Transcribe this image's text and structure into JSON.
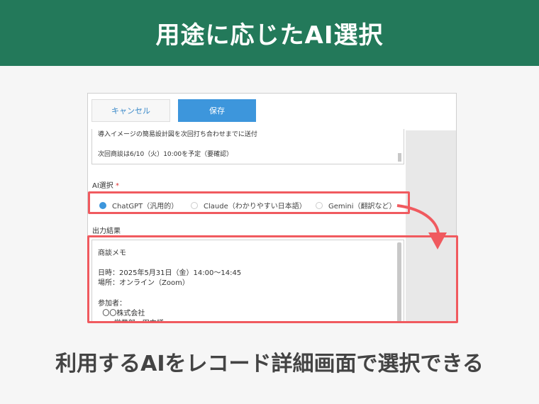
{
  "banner": {
    "title": "用途に応じたAI選択"
  },
  "toolbar": {
    "cancel_label": "キャンセル",
    "save_label": "保存"
  },
  "notes": {
    "line1": "導入イメージの簡易設計図を次回打ち合わせまでに送付",
    "line2": "次回商談は6/10（火）10:00を予定（要確認）"
  },
  "ai_select": {
    "label": "AI選択",
    "required_mark": "*",
    "options": [
      {
        "label": "ChatGPT（汎用的）",
        "selected": true
      },
      {
        "label": "Claude（わかりやすい日本語）",
        "selected": false
      },
      {
        "label": "Gemini（翻訳など）",
        "selected": false
      }
    ]
  },
  "output": {
    "label": "出力結果",
    "lines": [
      "商談メモ",
      "",
      "日時：2025年5月31日（金）14:00〜14:45",
      "場所：オンライン（Zoom）",
      "",
      "参加者：",
      "  〇〇株式会社",
      "    ・営業部　田中様"
    ]
  },
  "caption": "利用するAIをレコード詳細画面で選択できる",
  "colors": {
    "banner": "#23795a",
    "accent": "#3d96dc",
    "highlight": "#f05a5f"
  }
}
